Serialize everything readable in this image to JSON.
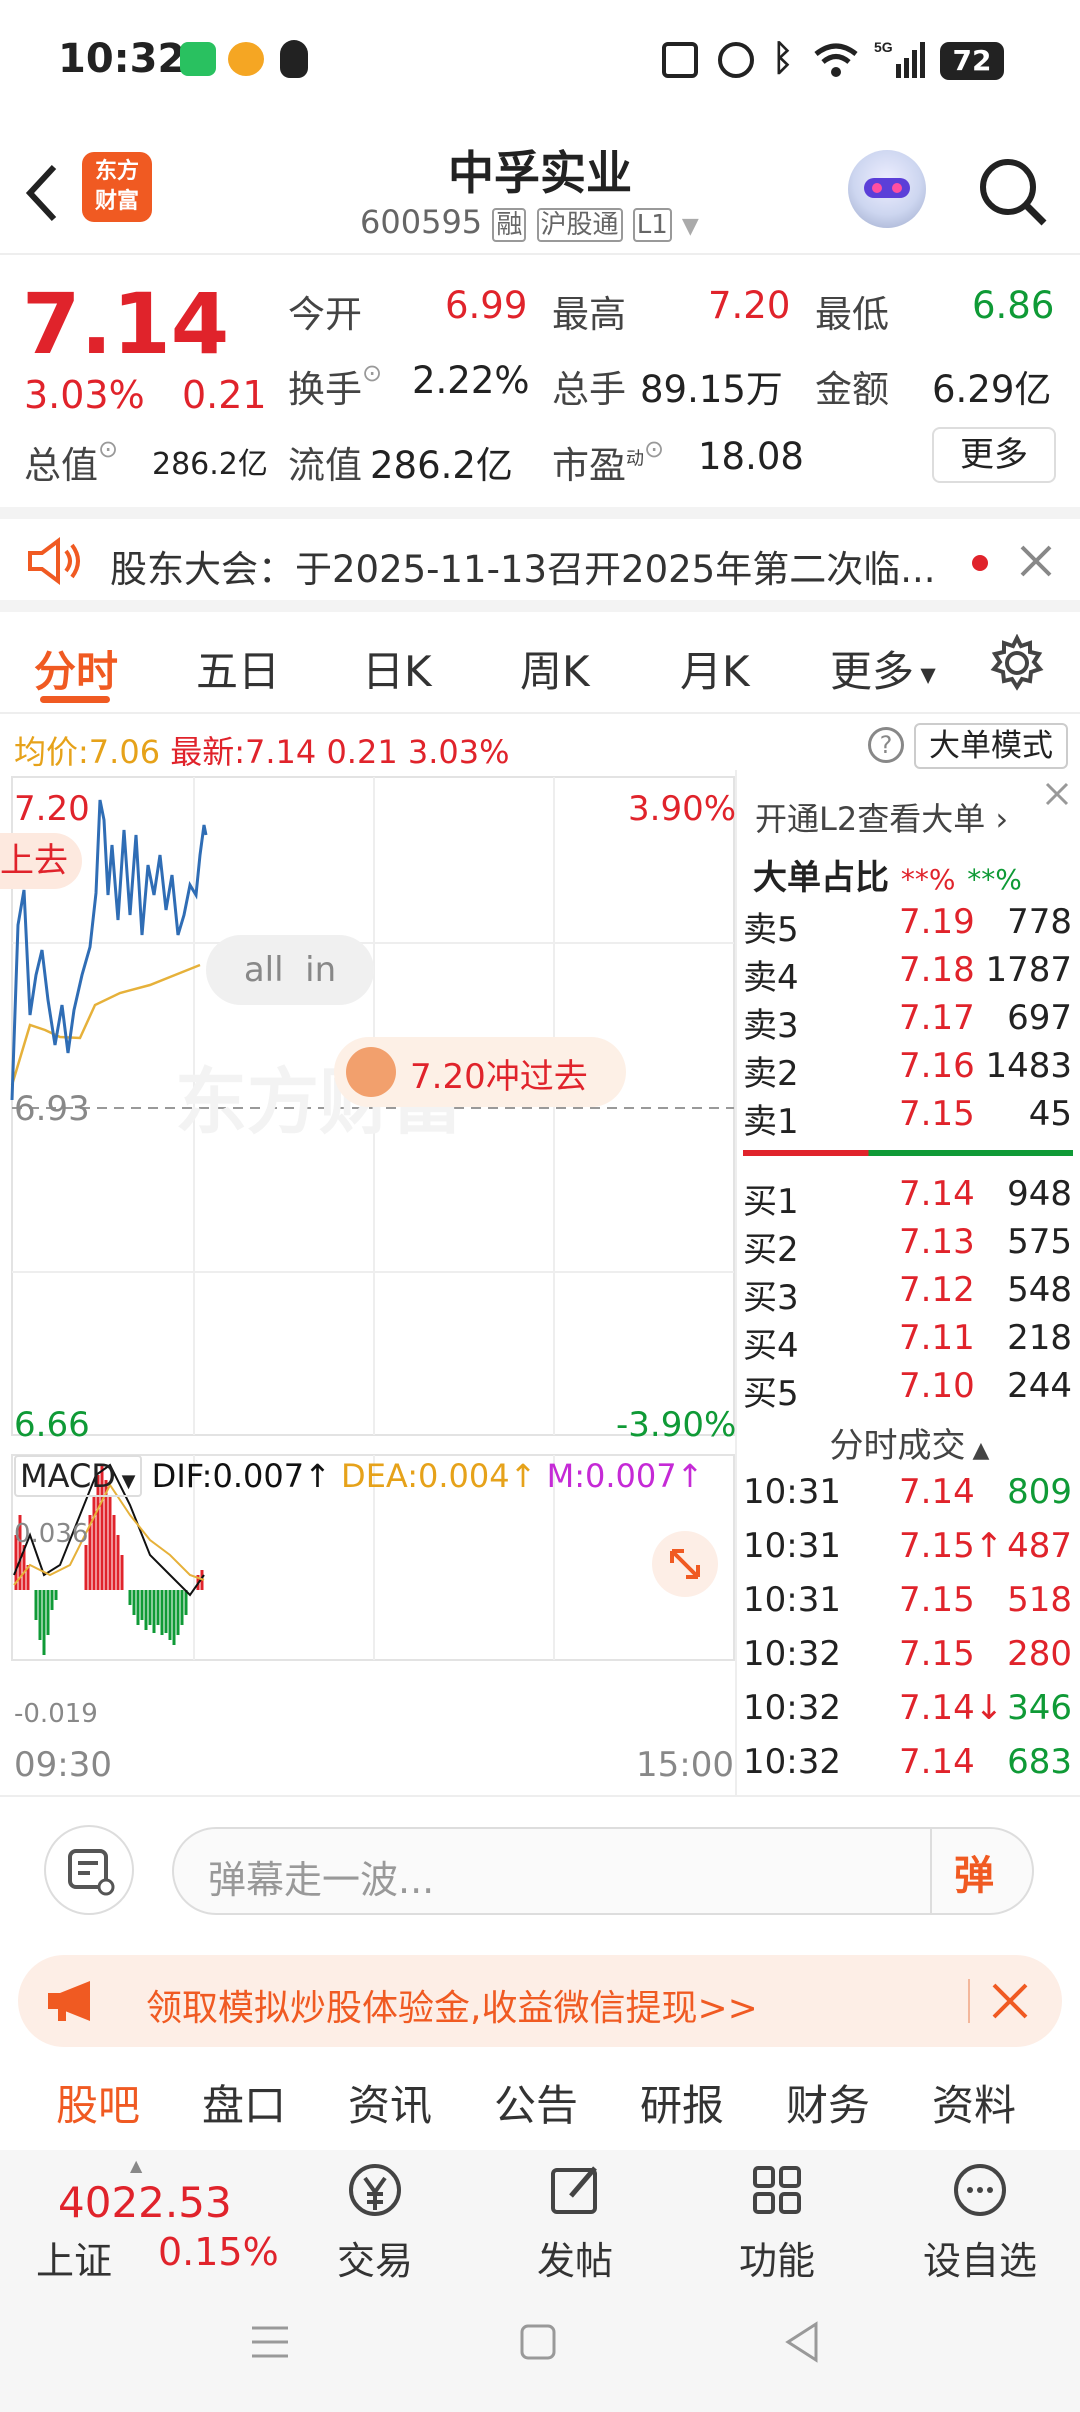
{
  "status": {
    "time": "10:32",
    "battery": "72"
  },
  "header": {
    "logo_line1": "东方",
    "logo_line2": "财富",
    "title": "中孚实业",
    "code": "600595",
    "tags": [
      "融",
      "沪股通",
      "L1"
    ]
  },
  "quote": {
    "price": "7.14",
    "pct": "3.03%",
    "chg": "0.21",
    "fields": [
      {
        "k": "今开",
        "v": "6.99"
      },
      {
        "k": "最高",
        "v": "7.20"
      },
      {
        "k": "最低",
        "v": "6.86"
      },
      {
        "k": "换手",
        "v": "2.22%"
      },
      {
        "k": "总手",
        "v": "89.15万"
      },
      {
        "k": "金额",
        "v": "6.29亿"
      },
      {
        "k": "总值",
        "v": "286.2亿"
      },
      {
        "k": "流值",
        "v": "286.2亿"
      },
      {
        "k": "市盈",
        "v": "18.08",
        "sup": "动"
      }
    ],
    "more": "更多"
  },
  "notice": {
    "text": "股东大会：于2025-11-13召开2025年第二次临..."
  },
  "tabs": [
    "分时",
    "五日",
    "日K",
    "周K",
    "月K",
    "更多"
  ],
  "chart": {
    "avg_label": "均价:",
    "avg": "7.06",
    "latest_label": "最新:",
    "latest": "7.14",
    "chg": "0.21",
    "pct": "3.03%",
    "big_mode": "大单模式",
    "y_top": "7.20",
    "y_mid": "6.93",
    "y_bot": "6.66",
    "pct_top": "3.90%",
    "pct_bot": "-3.90%",
    "bubble_left": "上去",
    "all_in": "all  in",
    "bubble": "7.20冲过去",
    "watermark": "东方财富",
    "macd": {
      "name": "MACD",
      "dif": "DIF:0.007↑",
      "dea": "DEA:0.004↑",
      "m": "M:0.007↑",
      "top": "0.036",
      "bot": "-0.019"
    },
    "t_start": "09:30",
    "t_end": "15:00"
  },
  "book": {
    "l2": "开通L2查看大单",
    "ratio_label": "大单占比",
    "ratio_red": "**%",
    "ratio_green": "**%",
    "sells": [
      {
        "l": "卖5",
        "p": "7.19",
        "v": "778"
      },
      {
        "l": "卖4",
        "p": "7.18",
        "v": "1787"
      },
      {
        "l": "卖3",
        "p": "7.17",
        "v": "697"
      },
      {
        "l": "卖2",
        "p": "7.16",
        "v": "1483"
      },
      {
        "l": "卖1",
        "p": "7.15",
        "v": "45"
      }
    ],
    "buys": [
      {
        "l": "买1",
        "p": "7.14",
        "v": "948"
      },
      {
        "l": "买2",
        "p": "7.13",
        "v": "575"
      },
      {
        "l": "买3",
        "p": "7.12",
        "v": "548"
      },
      {
        "l": "买4",
        "p": "7.11",
        "v": "218"
      },
      {
        "l": "买5",
        "p": "7.10",
        "v": "244"
      }
    ],
    "trades_title": "分时成交",
    "trades": [
      {
        "t": "10:31",
        "p": "7.14",
        "v": "809",
        "c": "green"
      },
      {
        "t": "10:31",
        "p": "7.15↑",
        "v": "487",
        "c": "red"
      },
      {
        "t": "10:31",
        "p": "7.15",
        "v": "518",
        "c": "red"
      },
      {
        "t": "10:32",
        "p": "7.15",
        "v": "280",
        "c": "red"
      },
      {
        "t": "10:32",
        "p": "7.14↓",
        "v": "346",
        "c": "green"
      },
      {
        "t": "10:32",
        "p": "7.14",
        "v": "683",
        "c": "green"
      }
    ]
  },
  "danmu": {
    "placeholder": "弹幕走一波...",
    "send": "弹"
  },
  "promo": {
    "text": "领取模拟炒股体验金,收益微信提现>>"
  },
  "bottomtabs": [
    "股吧",
    "盘口",
    "资讯",
    "公告",
    "研报",
    "财务",
    "资料"
  ],
  "bottomnav": {
    "index_value": "4022.53",
    "index_name": "上证",
    "index_pct": "0.15%",
    "items": [
      "交易",
      "发帖",
      "功能",
      "设自选"
    ]
  },
  "colors": {
    "red": "#e0232b",
    "green": "#0f9a36",
    "brand": "#f05a22",
    "price_line": "#2f6db5",
    "avg_line": "#e6b13a"
  }
}
